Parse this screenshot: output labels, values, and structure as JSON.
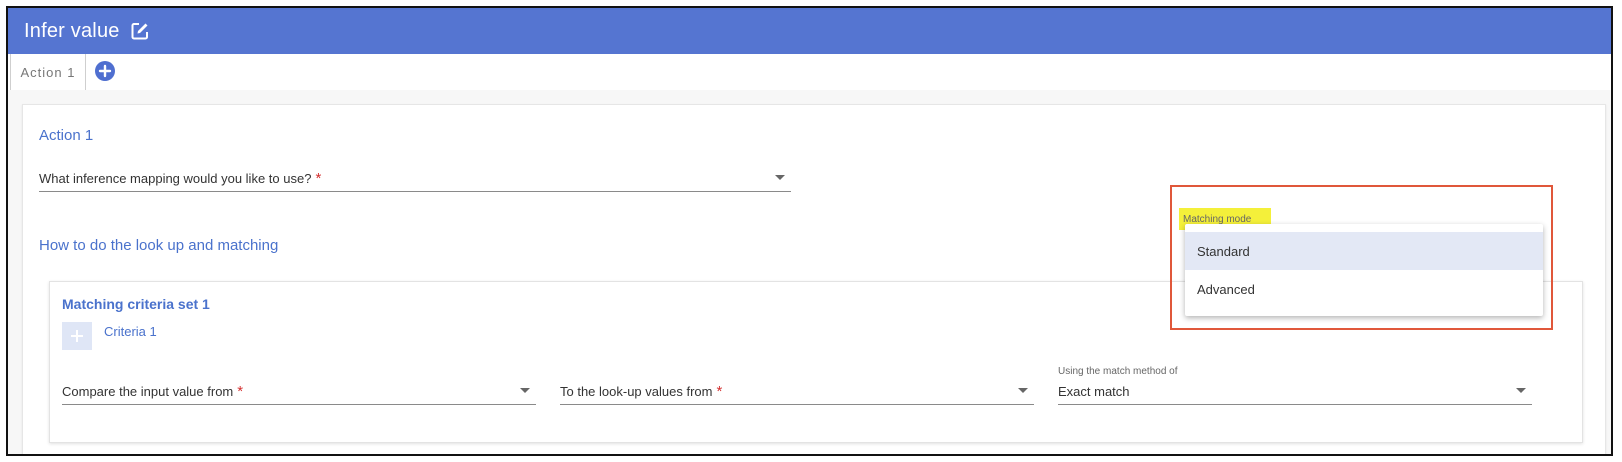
{
  "header": {
    "title": "Infer value"
  },
  "tabs": [
    {
      "label": "Action 1"
    }
  ],
  "card": {
    "title": "Action 1",
    "mapping_field": {
      "label": "What inference mapping would you like to use?",
      "required": "*"
    },
    "lookup_title": "How to do the look up and matching"
  },
  "matching_mode": {
    "label": "Matching mode",
    "options": [
      "Standard",
      "Advanced"
    ],
    "highlighted": "Standard"
  },
  "criteria_set": {
    "title": "Matching criteria set 1",
    "criteria_label": "Criteria 1",
    "compare_field": {
      "label": "Compare the input value from",
      "required": "*"
    },
    "lookup_field": {
      "label": "To the look-up values from",
      "required": "*"
    },
    "match_method": {
      "label": "Using the match method of",
      "value": "Exact match"
    }
  },
  "colors": {
    "header": "#5575d1",
    "accent": "#4a72cc",
    "required": "#d32f2f",
    "highlight": "#f4f03a",
    "annotation_box": "#e0573a"
  }
}
